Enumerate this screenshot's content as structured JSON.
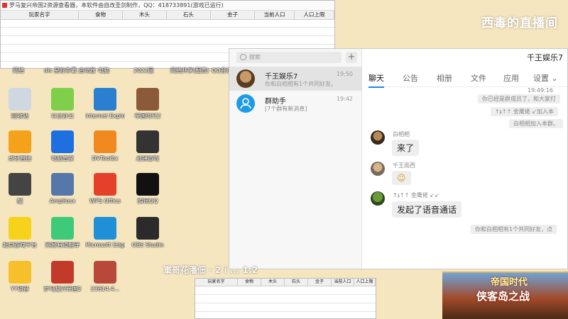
{
  "viewer": {
    "title": "罗马复兴帝国2资源查看器，本软件由自改圣剑制作，QQ：418733891(游戏已运行)",
    "columns": [
      "玩家名字",
      "食物",
      "木头",
      "石头",
      "金子",
      "当前人口",
      "人口上限"
    ]
  },
  "watermark": "西毒的直播间",
  "desktop": {
    "row_labels": [
      "网络",
      "dis 星际争霸 启动器",
      "电脑",
      "2022届",
      "网络共享(配置)",
      "QQ音乐"
    ],
    "icons": [
      {
        "label": "回收站",
        "icon": "recycle-bin-icon",
        "color": "#cfd8e0"
      },
      {
        "label": "以企办公",
        "icon": "flower-icon",
        "color": "#7fcf4a"
      },
      {
        "label": "Internet Explorer",
        "icon": "ie-icon",
        "color": "#2a7fd0"
      },
      {
        "label": "帝国时代2",
        "icon": "game-icon",
        "color": "#8a5a3a"
      },
      {
        "label": "虎牙直播",
        "icon": "huya-icon",
        "color": "#f3a21a"
      },
      {
        "label": "电脑管家",
        "icon": "shield-icon",
        "color": "#1e6fe0"
      },
      {
        "label": "DVToolEx",
        "icon": "dvtool-icon",
        "color": "#f08a20"
      },
      {
        "label": "战锤游戏",
        "icon": "gamepad-icon",
        "color": "#333333"
      },
      {
        "label": "龍",
        "icon": "dragon-icon",
        "color": "#444444"
      },
      {
        "label": "Ampliosx",
        "icon": "tool-icon",
        "color": "#5577aa"
      },
      {
        "label": "WPS Office",
        "icon": "wps-icon",
        "color": "#e5402a"
      },
      {
        "label": "腾讯QQ",
        "icon": "qq-icon",
        "color": "#111111"
      },
      {
        "label": "起点游戏平台",
        "icon": "duck-icon",
        "color": "#f6d21a"
      },
      {
        "label": "网易有道翻译",
        "icon": "android-icon",
        "color": "#3dcb7a"
      },
      {
        "label": "Microsoft Edge",
        "icon": "edge-icon",
        "color": "#1f8fd8"
      },
      {
        "label": "OBS Studio",
        "icon": "obs-icon",
        "color": "#2b2b2b"
      },
      {
        "label": "YY语音",
        "icon": "yy-icon",
        "color": "#f5c02a"
      },
      {
        "label": "罗马复兴帝国2",
        "icon": "rome-icon",
        "color": "#c23a2a"
      },
      {
        "label": "23614.4...",
        "icon": "photo-icon",
        "color": "#b8483a"
      }
    ]
  },
  "chat": {
    "search_placeholder": "搜索",
    "conversations": [
      {
        "name": "千王娱乐7",
        "preview": "你和白相相有1个共同好友。",
        "time": "19:50"
      },
      {
        "name": "群助手",
        "preview": "[7个群有新消息]",
        "time": "19:42"
      }
    ],
    "title": "千王娱乐7",
    "tabs": [
      "聊天",
      "公告",
      "相册",
      "文件",
      "应用",
      "设置 ⌄"
    ],
    "sys_time": "19:49:16",
    "sys_messages": [
      "你已经是群成员了，和大家打",
      "↑ኔ↑↑ 金鹰佬 ↙加入本",
      "白相相加入本群。"
    ],
    "messages": [
      {
        "sender": "白相相",
        "text": "来了"
      },
      {
        "sender": "千王雨西",
        "text": "☺"
      },
      {
        "sender": "↑ኔ↑↑ 金鹰佬 ↙↙",
        "text": "发起了语音通话"
      }
    ],
    "footer_sys": "你和白相相有1个共同好友，点"
  },
  "ad": {
    "line1": "帝国时代",
    "line2": "侠客岛之战"
  },
  "overlay": "軍哥花潘佃 · 2 i ... 1:2"
}
